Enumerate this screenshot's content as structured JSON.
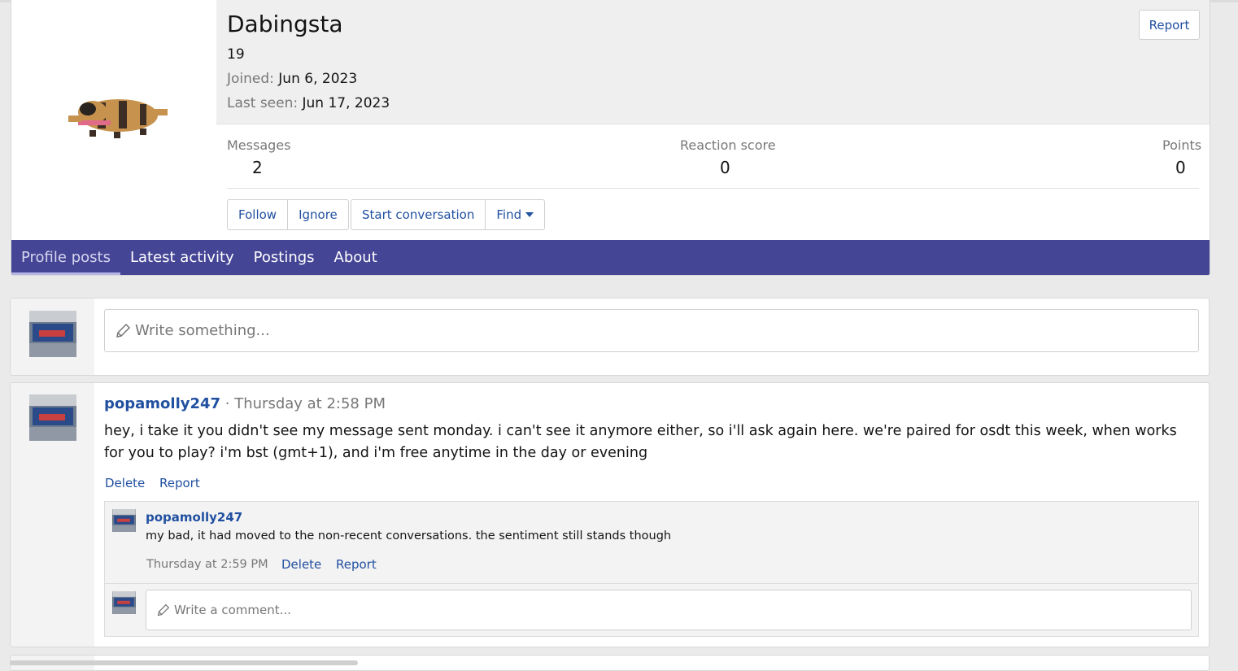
{
  "profile": {
    "username": "Dabingsta",
    "user_title": "19",
    "joined_label": "Joined:",
    "joined_value": "Jun 6, 2023",
    "last_seen_label": "Last seen:",
    "last_seen_value": "Jun 17, 2023",
    "report_label": "Report",
    "stats": {
      "messages_label": "Messages",
      "messages_value": "2",
      "reaction_label": "Reaction score",
      "reaction_value": "0",
      "points_label": "Points",
      "points_value": "0"
    },
    "buttons": {
      "follow": "Follow",
      "ignore": "Ignore",
      "start_conversation": "Start conversation",
      "find": "Find"
    }
  },
  "tabs": [
    {
      "label": "Profile posts",
      "active": true
    },
    {
      "label": "Latest activity",
      "active": false
    },
    {
      "label": "Postings",
      "active": false
    },
    {
      "label": "About",
      "active": false
    }
  ],
  "compose": {
    "placeholder": "Write something..."
  },
  "post": {
    "author": "popamolly247",
    "separator": " · ",
    "time": "Thursday at 2:58 PM",
    "text": "hey, i take it you didn't see my message sent monday. i can't see it anymore either, so i'll ask again here. we're paired for osdt this week, when works for you to play? i'm bst (gmt+1), and i'm free anytime in the day or evening",
    "delete_label": "Delete",
    "report_label": "Report",
    "comment": {
      "author": "popamolly247",
      "text": "my bad, it had moved to the non-recent conversations. the sentiment still stands though",
      "time": "Thursday at 2:59 PM",
      "delete_label": "Delete",
      "report_label": "Report"
    },
    "comment_placeholder": "Write a comment..."
  }
}
